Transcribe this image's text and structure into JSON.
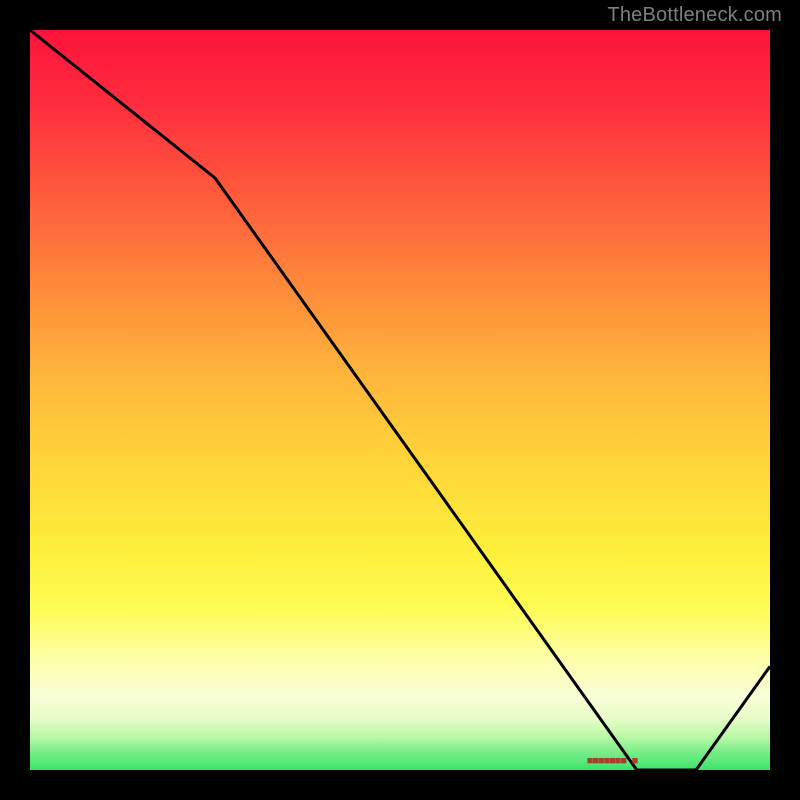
{
  "watermark": "TheBottleneck.com",
  "chart_data": {
    "type": "line",
    "title": "",
    "xlabel": "",
    "ylabel": "",
    "xlim": [
      0,
      100
    ],
    "ylim": [
      0,
      100
    ],
    "x": [
      0,
      25,
      82,
      90,
      100
    ],
    "values": [
      100,
      80,
      0,
      0,
      14
    ],
    "annotation": {
      "x": 82,
      "y": 0,
      "text": "■■■■■■■ ■"
    },
    "background_gradient": [
      "#fe133b",
      "#ffb33b",
      "#feee3a",
      "#3be36b"
    ],
    "grid": false,
    "legend": false
  }
}
